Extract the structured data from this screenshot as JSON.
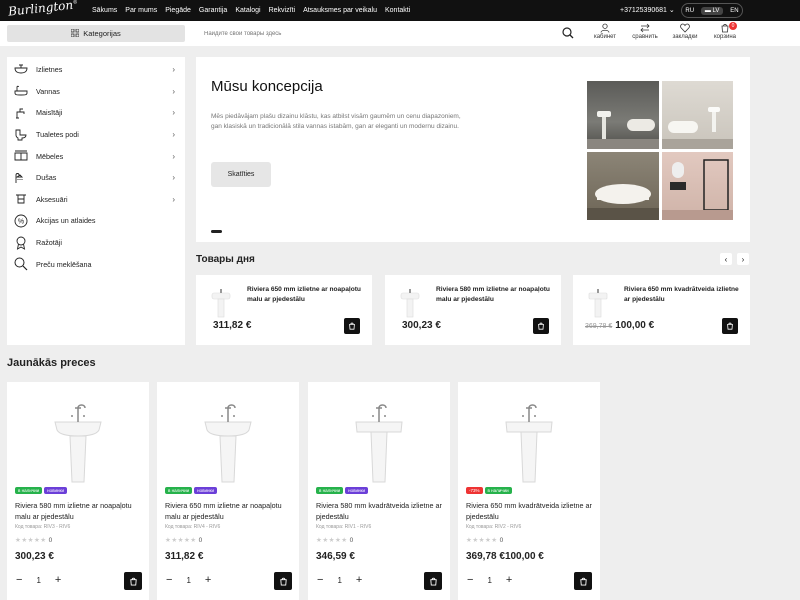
{
  "brand": {
    "logo": "Burlington"
  },
  "nav": [
    "Sākums",
    "Par mums",
    "Piegāde",
    "Garantija",
    "Katalogi",
    "Rekvizīti",
    "Atsauksmes par veikalu",
    "Kontakti"
  ],
  "phone": "+37125390681",
  "languages": [
    "RU",
    "LV",
    "EN"
  ],
  "active_language": "LV",
  "header": {
    "categories_label": "Kategorijas",
    "search_placeholder": "Найдите свои товары здесь",
    "icons": [
      {
        "label": "кабинет",
        "icon": "user-icon"
      },
      {
        "label": "сравнить",
        "icon": "compare-icon"
      },
      {
        "label": "закладки",
        "icon": "heart-icon"
      },
      {
        "label": "корзина",
        "icon": "cart-icon",
        "badge": "0"
      }
    ]
  },
  "sidebar": [
    {
      "label": "Izlietnes",
      "icon": "sink-icon",
      "arrow": true
    },
    {
      "label": "Vannas",
      "icon": "bathtub-icon",
      "arrow": true
    },
    {
      "label": "Maisītāji",
      "icon": "faucet-icon",
      "arrow": true
    },
    {
      "label": "Tualetes podi",
      "icon": "toilet-icon",
      "arrow": true
    },
    {
      "label": "Mēbeles",
      "icon": "furniture-icon",
      "arrow": true
    },
    {
      "label": "Dušas",
      "icon": "shower-icon",
      "arrow": true
    },
    {
      "label": "Aksesuāri",
      "icon": "accessory-icon",
      "arrow": true
    },
    {
      "label": "Akcijas un atlaides",
      "icon": "percent-icon",
      "arrow": false
    },
    {
      "label": "Ražotāji",
      "icon": "award-icon",
      "arrow": false
    },
    {
      "label": "Preču meklēšana",
      "icon": "search-icon",
      "arrow": false
    }
  ],
  "banner": {
    "title": "Mūsu koncepcija",
    "text": "Mēs piedāvājam plašu dizainu klāstu, kas atbilst visām gaumēm un cenu diapazoniem, gan klasiskā un tradicionālā stila vannas istabām, gan ar eleganti un modernu dizainu.",
    "button": "Skatīties"
  },
  "deals": {
    "title": "Товары дня",
    "items": [
      {
        "name": "Riviera 650 mm izlietne ar noapaļotu malu ar pjedestālu",
        "price": "311,82 €",
        "old_price": ""
      },
      {
        "name": "Riviera 580 mm izlietne ar noapaļotu malu ar pjedestālu",
        "price": "300,23 €",
        "old_price": ""
      },
      {
        "name": "Riviera 650 mm kvadrātveida izlietne ar pjedestālu",
        "price": "100,00 €",
        "old_price": "369,78 €"
      }
    ]
  },
  "new_products": {
    "title": "Jaunākās preces",
    "items": [
      {
        "tags": [
          {
            "t": "в наличии",
            "c": "green"
          },
          {
            "t": "новинки",
            "c": "purple"
          }
        ],
        "name": "Riviera 580 mm izlietne ar noapaļotu malu ar pjedestālu",
        "code": "Код товара: RIV3 - RIV6",
        "rating_count": "0",
        "price": "300,23 €",
        "old_price": "",
        "qty": "1"
      },
      {
        "tags": [
          {
            "t": "в наличии",
            "c": "green"
          },
          {
            "t": "новинки",
            "c": "purple"
          }
        ],
        "name": "Riviera 650 mm izlietne ar noapaļotu malu ar pjedestālu",
        "code": "Код товара: RIV4 - RIV6",
        "rating_count": "0",
        "price": "311,82 €",
        "old_price": "",
        "qty": "1"
      },
      {
        "tags": [
          {
            "t": "в наличии",
            "c": "green"
          },
          {
            "t": "новинки",
            "c": "purple"
          }
        ],
        "name": "Riviera 580 mm kvadrātveida izlietne ar pjedestālu",
        "code": "Код товара: RIV1 - RIV6",
        "rating_count": "0",
        "price": "346,59 €",
        "old_price": "",
        "qty": "1"
      },
      {
        "tags": [
          {
            "t": "-73%",
            "c": "red"
          },
          {
            "t": "в наличии",
            "c": "green"
          }
        ],
        "name": "Riviera 650 mm kvadrātveida izlietne ar pjedestālu",
        "code": "Код товара: RIV2 - RIV6",
        "rating_count": "0",
        "price": "100,00 €",
        "old_price": "369,78 €",
        "qty": "1"
      }
    ]
  },
  "colors": {
    "accent": "#111111",
    "in_stock": "#26b24b",
    "new": "#6b3fd8",
    "sale": "#ee3333"
  }
}
